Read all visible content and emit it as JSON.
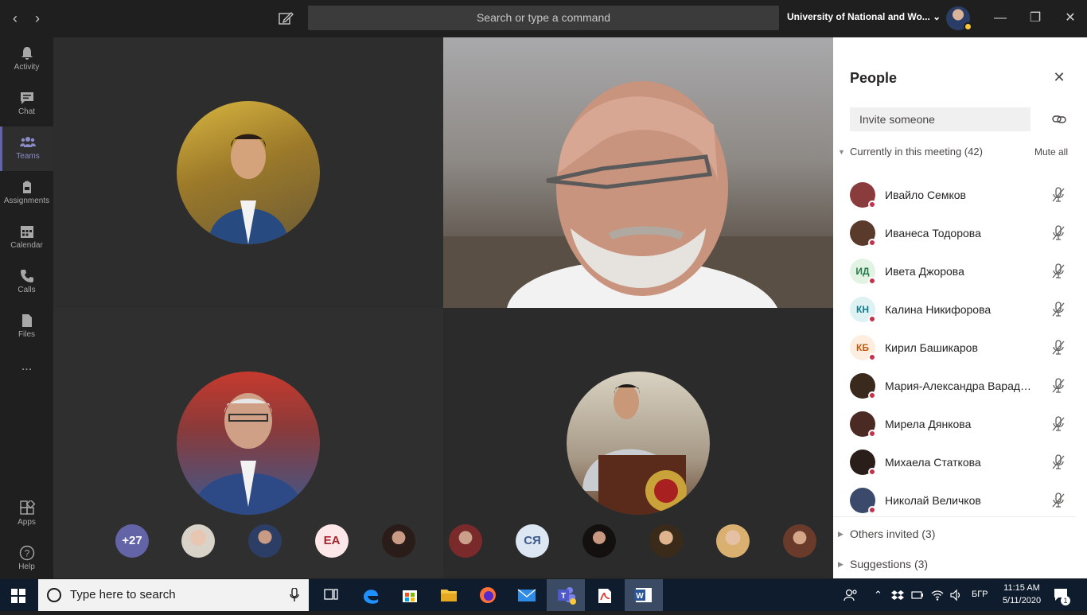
{
  "titlebar": {
    "search_placeholder": "Search or type a command",
    "org_name": "University of National and Wo...",
    "back_icon": "chevron-left-icon",
    "forward_icon": "chevron-right-icon",
    "compose_icon": "compose-icon"
  },
  "rail": {
    "items": [
      {
        "label": "Activity",
        "icon": "bell-icon"
      },
      {
        "label": "Chat",
        "icon": "chat-icon"
      },
      {
        "label": "Teams",
        "icon": "teams-icon",
        "active": true
      },
      {
        "label": "Assignments",
        "icon": "backpack-icon"
      },
      {
        "label": "Calendar",
        "icon": "calendar-icon"
      },
      {
        "label": "Calls",
        "icon": "phone-icon"
      },
      {
        "label": "Files",
        "icon": "file-icon"
      }
    ],
    "more": "...",
    "bottom": [
      {
        "label": "Apps",
        "icon": "apps-icon"
      },
      {
        "label": "Help",
        "icon": "help-icon"
      }
    ]
  },
  "strip": {
    "overflow_count": "+27",
    "initials": [
      "EA",
      "СЯ"
    ]
  },
  "people_panel": {
    "title": "People",
    "invite_placeholder": "Invite someone",
    "current_section": "Currently in this meeting (42)",
    "mute_all": "Mute all",
    "participants": [
      {
        "name": "Ивайло Семков",
        "initials": "",
        "avatar_color": "#8a3b3b"
      },
      {
        "name": "Иванеса Тодорова",
        "initials": "",
        "avatar_color": "#5a3a2a"
      },
      {
        "name": "Ивета Джорова",
        "initials": "ИД",
        "avatar_color": "#e2f3e4",
        "text_color": "#237b4b"
      },
      {
        "name": "Калина Никифорова",
        "initials": "КН",
        "avatar_color": "#def1f3",
        "text_color": "#0e7a8a"
      },
      {
        "name": "Кирил Башикаров",
        "initials": "КБ",
        "avatar_color": "#fdeee0",
        "text_color": "#c15a0e"
      },
      {
        "name": "Мария-Александра Варадинова",
        "initials": "",
        "avatar_color": "#3a2a1e"
      },
      {
        "name": "Мирела Дянкова",
        "initials": "",
        "avatar_color": "#4a2a22"
      },
      {
        "name": "Михаела Статкова",
        "initials": "",
        "avatar_color": "#2a1e1a"
      },
      {
        "name": "Николай Величков",
        "initials": "",
        "avatar_color": "#3b4a6a"
      }
    ],
    "others_invited": "Others invited (3)",
    "suggestions": "Suggestions (3)"
  },
  "taskbar": {
    "search_placeholder": "Type here to search",
    "language": "БГР",
    "time": "11:15 AM",
    "date": "5/11/2020",
    "notification_count": "1"
  },
  "colors": {
    "accent": "#6264a7",
    "presence_busy": "#c4314b",
    "presence_away": "#f8c83c"
  }
}
